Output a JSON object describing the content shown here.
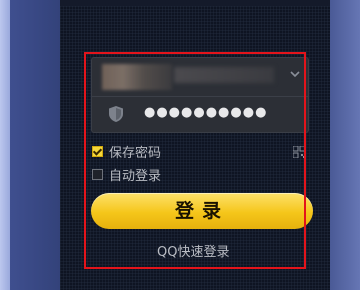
{
  "login": {
    "account": {
      "value": "",
      "dropdown_icon": "chevron-down-icon"
    },
    "password": {
      "masked_value": "●●●●●●●●●●",
      "security_icon": "shield-icon"
    },
    "options": {
      "remember_password_label": "保存密码",
      "remember_password_checked": true,
      "auto_login_label": "自动登录",
      "auto_login_checked": false
    },
    "qr_icon": "qr-code-icon",
    "login_button_label": "登录",
    "quick_login_label": "QQ快速登录"
  },
  "colors": {
    "panel_bg": "#0e1422",
    "button_yellow": "#f5c61a",
    "highlight_red": "#e3141b",
    "text_gray": "#b9bcc3"
  }
}
